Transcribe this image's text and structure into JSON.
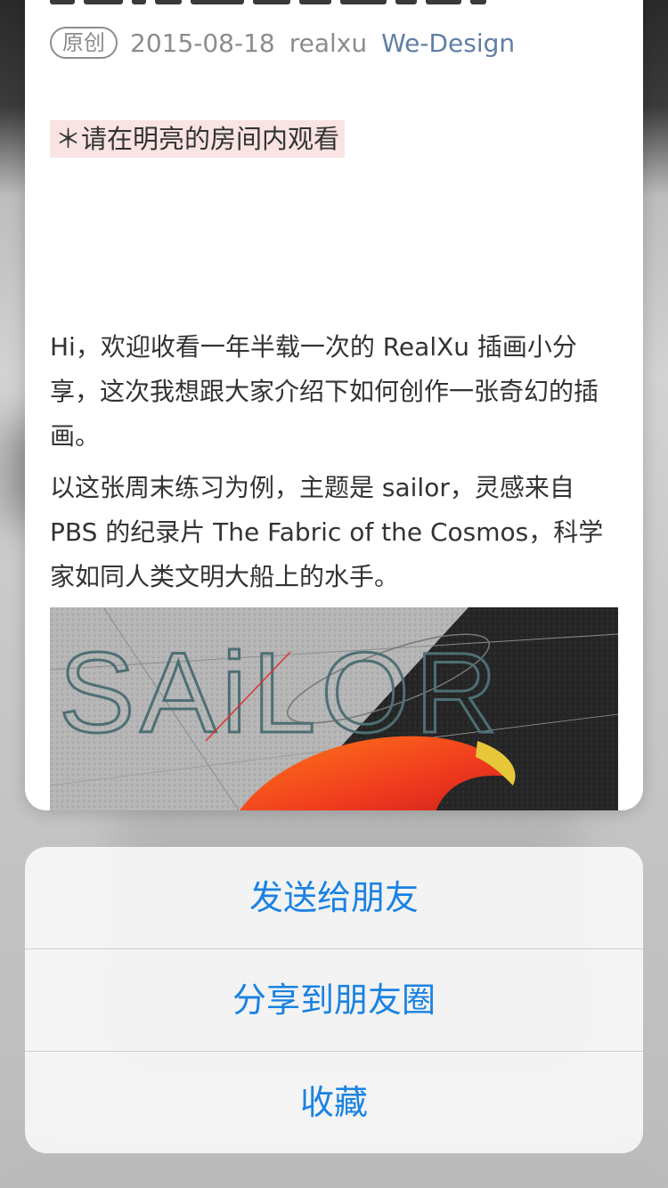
{
  "article": {
    "badge": "原创",
    "date": "2015-08-18",
    "author": "realxu",
    "account": "We-Design",
    "notice": "＊请在明亮的房间内观看",
    "paragraphs": [
      "Hi，欢迎收看一年半载一次的 RealXu 插画小分享，这次我想跟大家介绍下如何创作一张奇幻的插画。",
      "以这张周末练习为例，主题是 sailor，灵感来自 PBS 的纪录片 The Fabric of the Cosmos，科学家如同人类文明大船上的水手。"
    ],
    "artwork_text": "SAiLOR"
  },
  "action_sheet": {
    "items": [
      "发送给朋友",
      "分享到朋友圈",
      "收藏"
    ]
  },
  "colors": {
    "link": "#607fa6",
    "action": "#1a82e2",
    "notice_bg": "#f9e3e3"
  }
}
